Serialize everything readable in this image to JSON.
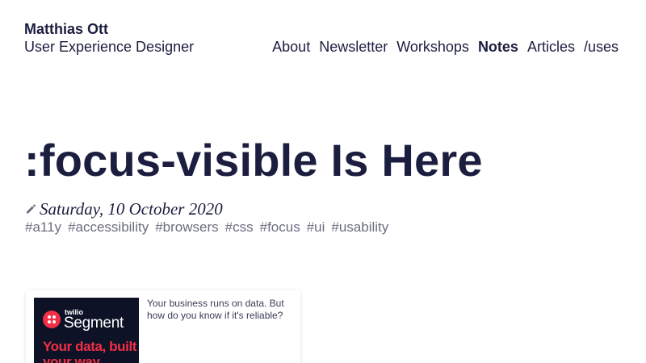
{
  "site": {
    "name": "Matthias Ott",
    "role": "User Experience Designer"
  },
  "nav": {
    "items": [
      {
        "label": "About",
        "active": false
      },
      {
        "label": "Newsletter",
        "active": false
      },
      {
        "label": "Workshops",
        "active": false
      },
      {
        "label": "Notes",
        "active": true
      },
      {
        "label": "Articles",
        "active": false
      },
      {
        "label": "/uses",
        "active": false
      }
    ]
  },
  "post": {
    "title": ":focus-visible Is Here",
    "date": "Saturday, 10 October 2020",
    "tags": [
      "#a11y",
      "#accessibility",
      "#browsers",
      "#css",
      "#focus",
      "#ui",
      "#usability"
    ]
  },
  "ad": {
    "brand_small": "twilio",
    "brand": "Segment",
    "headline": "Your data, built your way",
    "text": "Your business runs on data. But how do you know if it's reliable?",
    "accent_color": "#f22f46",
    "background_color": "#0d1226"
  },
  "colors": {
    "text": "#1c1e3f",
    "muted": "#6b6d80"
  }
}
